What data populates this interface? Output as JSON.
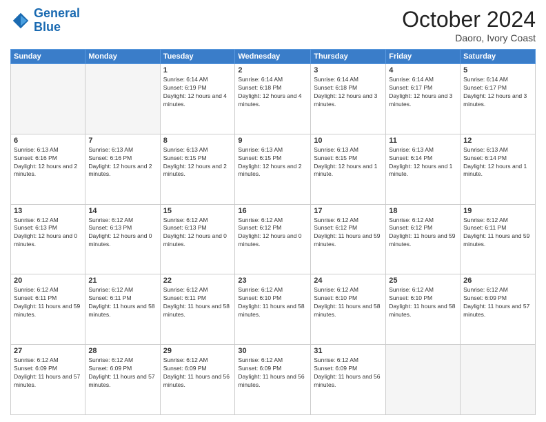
{
  "logo": {
    "line1": "General",
    "line2": "Blue"
  },
  "header": {
    "month": "October 2024",
    "location": "Daoro, Ivory Coast"
  },
  "days_of_week": [
    "Sunday",
    "Monday",
    "Tuesday",
    "Wednesday",
    "Thursday",
    "Friday",
    "Saturday"
  ],
  "weeks": [
    [
      {
        "day": "",
        "info": ""
      },
      {
        "day": "",
        "info": ""
      },
      {
        "day": "1",
        "info": "Sunrise: 6:14 AM\nSunset: 6:19 PM\nDaylight: 12 hours and 4 minutes."
      },
      {
        "day": "2",
        "info": "Sunrise: 6:14 AM\nSunset: 6:18 PM\nDaylight: 12 hours and 4 minutes."
      },
      {
        "day": "3",
        "info": "Sunrise: 6:14 AM\nSunset: 6:18 PM\nDaylight: 12 hours and 3 minutes."
      },
      {
        "day": "4",
        "info": "Sunrise: 6:14 AM\nSunset: 6:17 PM\nDaylight: 12 hours and 3 minutes."
      },
      {
        "day": "5",
        "info": "Sunrise: 6:14 AM\nSunset: 6:17 PM\nDaylight: 12 hours and 3 minutes."
      }
    ],
    [
      {
        "day": "6",
        "info": "Sunrise: 6:13 AM\nSunset: 6:16 PM\nDaylight: 12 hours and 2 minutes."
      },
      {
        "day": "7",
        "info": "Sunrise: 6:13 AM\nSunset: 6:16 PM\nDaylight: 12 hours and 2 minutes."
      },
      {
        "day": "8",
        "info": "Sunrise: 6:13 AM\nSunset: 6:15 PM\nDaylight: 12 hours and 2 minutes."
      },
      {
        "day": "9",
        "info": "Sunrise: 6:13 AM\nSunset: 6:15 PM\nDaylight: 12 hours and 2 minutes."
      },
      {
        "day": "10",
        "info": "Sunrise: 6:13 AM\nSunset: 6:15 PM\nDaylight: 12 hours and 1 minute."
      },
      {
        "day": "11",
        "info": "Sunrise: 6:13 AM\nSunset: 6:14 PM\nDaylight: 12 hours and 1 minute."
      },
      {
        "day": "12",
        "info": "Sunrise: 6:13 AM\nSunset: 6:14 PM\nDaylight: 12 hours and 1 minute."
      }
    ],
    [
      {
        "day": "13",
        "info": "Sunrise: 6:12 AM\nSunset: 6:13 PM\nDaylight: 12 hours and 0 minutes."
      },
      {
        "day": "14",
        "info": "Sunrise: 6:12 AM\nSunset: 6:13 PM\nDaylight: 12 hours and 0 minutes."
      },
      {
        "day": "15",
        "info": "Sunrise: 6:12 AM\nSunset: 6:13 PM\nDaylight: 12 hours and 0 minutes."
      },
      {
        "day": "16",
        "info": "Sunrise: 6:12 AM\nSunset: 6:12 PM\nDaylight: 12 hours and 0 minutes."
      },
      {
        "day": "17",
        "info": "Sunrise: 6:12 AM\nSunset: 6:12 PM\nDaylight: 11 hours and 59 minutes."
      },
      {
        "day": "18",
        "info": "Sunrise: 6:12 AM\nSunset: 6:12 PM\nDaylight: 11 hours and 59 minutes."
      },
      {
        "day": "19",
        "info": "Sunrise: 6:12 AM\nSunset: 6:11 PM\nDaylight: 11 hours and 59 minutes."
      }
    ],
    [
      {
        "day": "20",
        "info": "Sunrise: 6:12 AM\nSunset: 6:11 PM\nDaylight: 11 hours and 59 minutes."
      },
      {
        "day": "21",
        "info": "Sunrise: 6:12 AM\nSunset: 6:11 PM\nDaylight: 11 hours and 58 minutes."
      },
      {
        "day": "22",
        "info": "Sunrise: 6:12 AM\nSunset: 6:11 PM\nDaylight: 11 hours and 58 minutes."
      },
      {
        "day": "23",
        "info": "Sunrise: 6:12 AM\nSunset: 6:10 PM\nDaylight: 11 hours and 58 minutes."
      },
      {
        "day": "24",
        "info": "Sunrise: 6:12 AM\nSunset: 6:10 PM\nDaylight: 11 hours and 58 minutes."
      },
      {
        "day": "25",
        "info": "Sunrise: 6:12 AM\nSunset: 6:10 PM\nDaylight: 11 hours and 58 minutes."
      },
      {
        "day": "26",
        "info": "Sunrise: 6:12 AM\nSunset: 6:09 PM\nDaylight: 11 hours and 57 minutes."
      }
    ],
    [
      {
        "day": "27",
        "info": "Sunrise: 6:12 AM\nSunset: 6:09 PM\nDaylight: 11 hours and 57 minutes."
      },
      {
        "day": "28",
        "info": "Sunrise: 6:12 AM\nSunset: 6:09 PM\nDaylight: 11 hours and 57 minutes."
      },
      {
        "day": "29",
        "info": "Sunrise: 6:12 AM\nSunset: 6:09 PM\nDaylight: 11 hours and 56 minutes."
      },
      {
        "day": "30",
        "info": "Sunrise: 6:12 AM\nSunset: 6:09 PM\nDaylight: 11 hours and 56 minutes."
      },
      {
        "day": "31",
        "info": "Sunrise: 6:12 AM\nSunset: 6:09 PM\nDaylight: 11 hours and 56 minutes."
      },
      {
        "day": "",
        "info": ""
      },
      {
        "day": "",
        "info": ""
      }
    ]
  ]
}
